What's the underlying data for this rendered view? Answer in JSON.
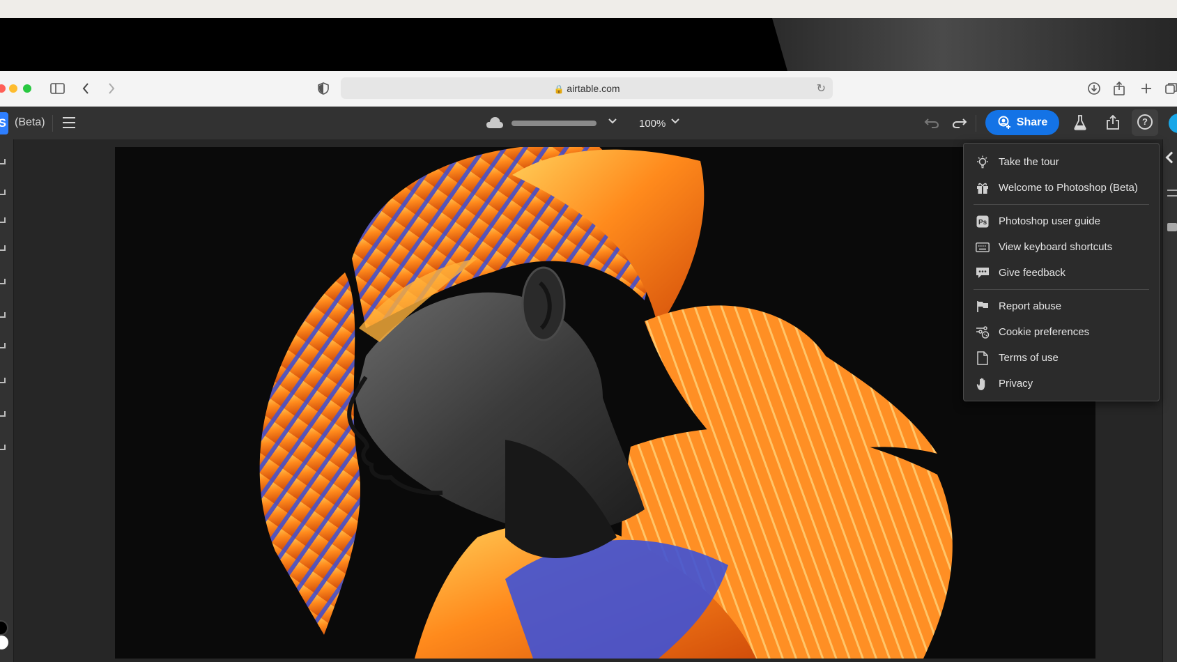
{
  "browser": {
    "url": "airtable.com",
    "icons": [
      "sidebar-icon",
      "back-icon",
      "forward-icon",
      "shield-icon",
      "lock-icon",
      "reload-icon",
      "download-icon",
      "share-icon",
      "new-tab-icon",
      "tabs-icon"
    ]
  },
  "app": {
    "logo_text": "S",
    "beta_label": "(Beta)",
    "zoom": "100%",
    "share_label": "Share",
    "help_symbol": "?",
    "colors": {
      "accent": "#1473e6",
      "avatar": "#19a7e8",
      "background": "#323232"
    }
  },
  "help_menu": {
    "items": [
      {
        "label": "Take the tour",
        "icon": "lightbulb-icon"
      },
      {
        "label": "Welcome to Photoshop (Beta)",
        "icon": "gift-icon"
      },
      {
        "label": "Photoshop user guide",
        "icon": "ps-icon"
      },
      {
        "label": "View keyboard shortcuts",
        "icon": "keyboard-icon"
      },
      {
        "label": "Give feedback",
        "icon": "feedback-icon"
      },
      {
        "label": "Report abuse",
        "icon": "flag-icon"
      },
      {
        "label": "Cookie preferences",
        "icon": "cookie-icon"
      },
      {
        "label": "Terms of use",
        "icon": "document-icon"
      },
      {
        "label": "Privacy",
        "icon": "hand-icon"
      }
    ]
  },
  "canvas": {
    "image": "portrait-with-fish-fins"
  }
}
